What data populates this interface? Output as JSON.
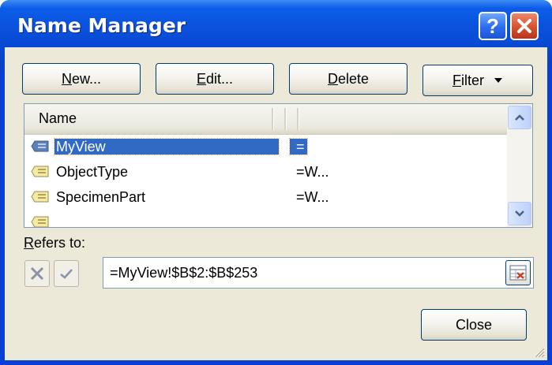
{
  "window": {
    "title": "Name Manager",
    "help_label": "?",
    "colors": {
      "titlebar": "#0a52dd",
      "client": "#ece9d8",
      "selection": "#316ac5",
      "close": "#d5512e"
    }
  },
  "toolbar": {
    "new_prefix": "",
    "new_mnemonic": "N",
    "new_rest": "ew...",
    "edit_prefix": "",
    "edit_mnemonic": "E",
    "edit_rest": "dit...",
    "delete_prefix": "",
    "delete_mnemonic": "D",
    "delete_rest": "elete",
    "filter_prefix": "",
    "filter_mnemonic": "F",
    "filter_rest": "ilter",
    "filter_icon": "dropdown-arrow-icon"
  },
  "list": {
    "columns": [
      "Name"
    ],
    "rows": [
      {
        "name": "MyView",
        "refers": "=",
        "selected": true
      },
      {
        "name": "ObjectType",
        "refers": "=W...",
        "selected": false
      },
      {
        "name": "SpecimenPart",
        "refers": "=W...",
        "selected": false
      },
      {
        "name": "",
        "refers": "",
        "selected": false
      }
    ]
  },
  "refers": {
    "label_mnemonic": "R",
    "label_rest": "efers to:",
    "value": "=MyView!$B$2:$B$253"
  },
  "footer": {
    "close_label": "Close"
  }
}
